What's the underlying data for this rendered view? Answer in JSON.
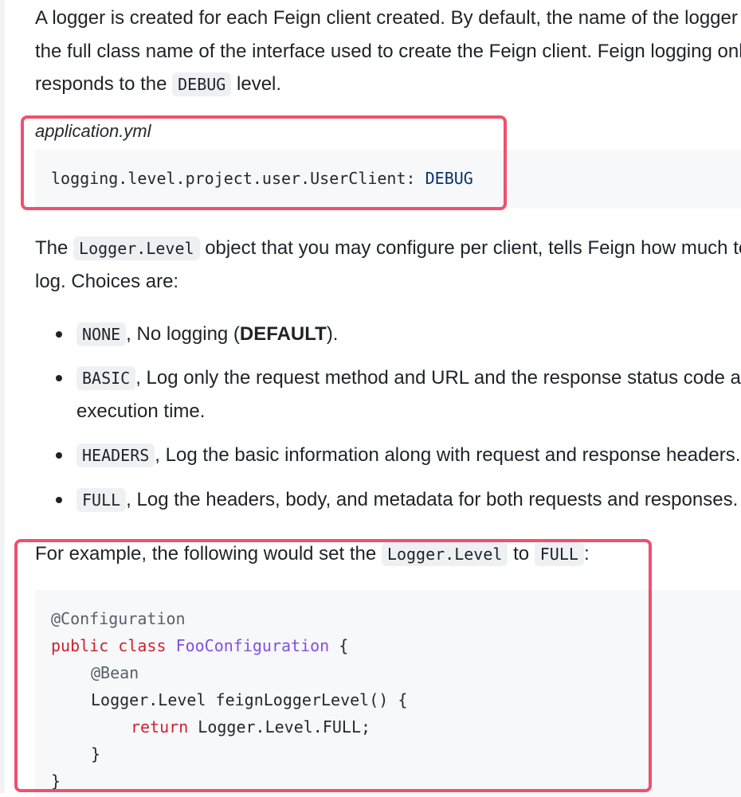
{
  "intro": {
    "line1": "A logger is created for each Feign client created. By default, the name of the logger is",
    "line2": "the full class name of the interface used to create the Feign client. Feign logging only",
    "line3_pre": "responds to the ",
    "line3_code": "DEBUG",
    "line3_post": " level."
  },
  "yml_block": {
    "filename": "application.yml",
    "key": "logging.level.project.user.UserClient:",
    "value": "DEBUG"
  },
  "level_para": {
    "pre": "The ",
    "code": "Logger.Level",
    "post": " object that you may configure per client, tells Feign how much to",
    "line2": "log. Choices are:"
  },
  "options": [
    {
      "code": "NONE",
      "text_pre": ", No logging (",
      "bold": "DEFAULT",
      "text_post": ")."
    },
    {
      "code": "BASIC",
      "text": ", Log only the request method and URL and the response status code and",
      "line2": "execution time."
    },
    {
      "code": "HEADERS",
      "text": ", Log the basic information along with request and response headers."
    },
    {
      "code": "FULL",
      "text": ", Log the headers, body, and metadata for both requests and responses."
    }
  ],
  "example": {
    "pre": "For example, the following would set the ",
    "code1": "Logger.Level",
    "mid": " to ",
    "code2": "FULL",
    "post": ":"
  },
  "java_code": {
    "l1": "@Configuration",
    "l2_kw1": "public",
    "l2_kw2": "class",
    "l2_cls": "FooConfiguration",
    "l2_rest": " {",
    "l3": "@Bean",
    "l4": "Logger.Level feignLoggerLevel() {",
    "l5_kw": "return",
    "l5_rest": " Logger.Level.FULL;",
    "l6": "}",
    "l7": "}"
  },
  "colors": {
    "highlight_border": "#f0506e",
    "code_bg": "#f6f8fa",
    "inline_code_bg": "#eef1f4",
    "keyword": "#cf222e",
    "class_name": "#8250df",
    "annotation": "#57606a"
  }
}
